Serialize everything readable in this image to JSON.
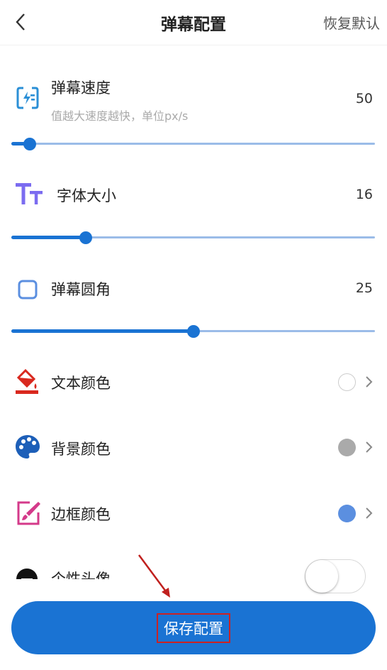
{
  "header": {
    "title": "弹幕配置",
    "reset_label": "恢复默认"
  },
  "speed": {
    "title": "弹幕速度",
    "subtitle": "值越大速度越快，单位px/s",
    "value": "50",
    "slider_fraction": 0.05
  },
  "font_size": {
    "title": "字体大小",
    "value": "16",
    "slider_fraction": 0.205
  },
  "radius": {
    "title": "弹幕圆角",
    "value": "25",
    "slider_fraction": 0.5
  },
  "text_color": {
    "title": "文本颜色",
    "color": "#ffffff"
  },
  "bg_color": {
    "title": "背景颜色",
    "color": "#aaaaaa"
  },
  "border_color": {
    "title": "边框颜色",
    "color": "#5b8fe0"
  },
  "avatar": {
    "title": "个性头像",
    "enabled": false
  },
  "save_label": "保存配置",
  "colors": {
    "accent": "#1a73d3",
    "track": "#9bbce8"
  }
}
